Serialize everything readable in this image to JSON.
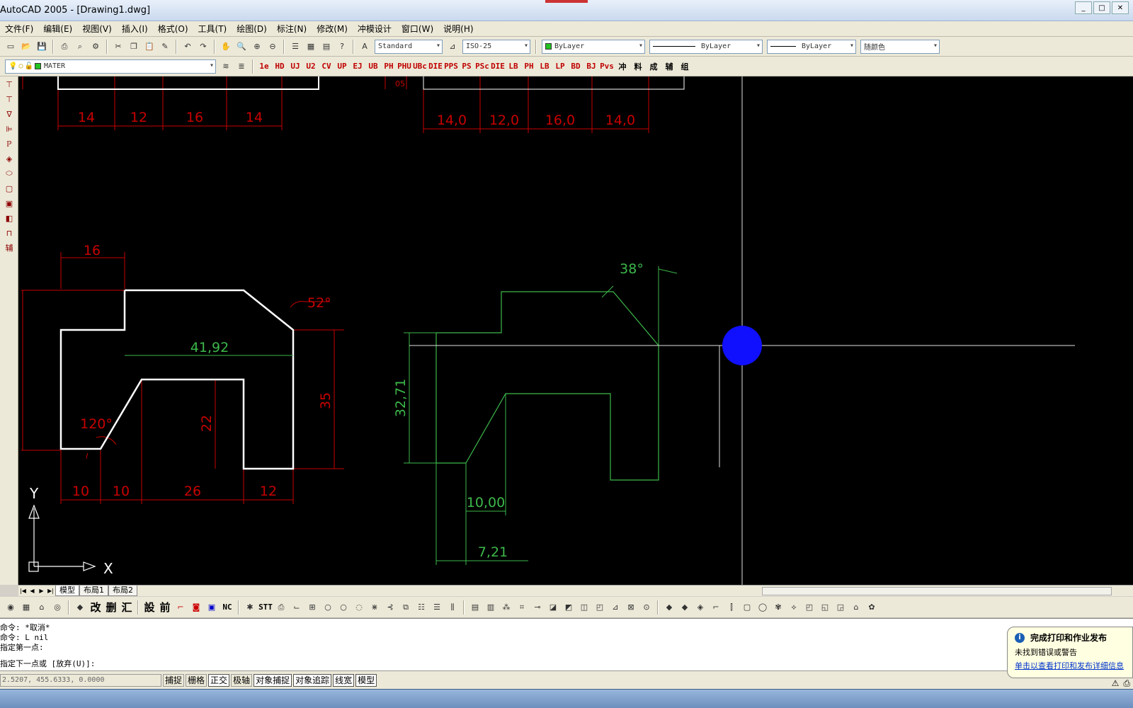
{
  "window": {
    "title": "AutoCAD 2005 - [Drawing1.dwg]"
  },
  "menu": [
    "文件(F)",
    "编辑(E)",
    "视图(V)",
    "插入(I)",
    "格式(O)",
    "工具(T)",
    "绘图(D)",
    "标注(N)",
    "修改(M)",
    "冲模设计",
    "窗口(W)",
    "说明(H)"
  ],
  "toolbar": {
    "text_style": "Standard",
    "dim_style": "ISO-25",
    "layer_color": "ByLayer",
    "linetype": "ByLayer",
    "lineweight": "ByLayer",
    "plot_style": "随颜色",
    "layer_name": "MATER"
  },
  "custom_buttons": [
    "1e",
    "HD",
    "UJ",
    "U2",
    "CV",
    "UP",
    "EJ",
    "UB",
    "PH",
    "PHU",
    "UBc",
    "DIE",
    "PPS",
    "PS",
    "PSc",
    "DIE",
    "LB",
    "PH",
    "LB",
    "LP",
    "BD",
    "BJ",
    "Pvs",
    "冲",
    "料",
    "成",
    "辅",
    "组"
  ],
  "bottom_toolbar": [
    "改",
    "删",
    "汇",
    "設",
    "前",
    "STT",
    "NC"
  ],
  "drawing": {
    "colors": {
      "red": "#c80000",
      "green": "#3cb84a",
      "white": "#ffffff",
      "blue": "#1010ff",
      "crosshair": "#e0e0e0"
    },
    "left_top_dims": [
      "14",
      "12",
      "16",
      "14"
    ],
    "right_top_dims": [
      "14,0",
      "12,0",
      "16,0",
      "14,0"
    ],
    "left_part": {
      "dim_top": "16",
      "angle_top": "52°",
      "width_label": "41,92",
      "height_label": "35",
      "inner_height": "22",
      "angle_bottom": "120°",
      "bottom_dims": [
        "10",
        "10",
        "26",
        "12"
      ]
    },
    "right_part": {
      "angle": "38°",
      "height_label": "32,71",
      "dim_a": "10,00",
      "dim_b": "7,21"
    },
    "ucs": {
      "x": "X",
      "y": "Y"
    },
    "top_small_label": "05"
  },
  "layout_tabs": [
    "模型",
    "布局1",
    "布局2"
  ],
  "command_lines": [
    "命令: *取消*",
    "命令: L nil",
    "指定第一点:"
  ],
  "command_prompt": "指定下一点或 [放弃(U)]:",
  "status": {
    "coords": "2.5207,  455.6333, 0.0000",
    "buttons": [
      "捕捉",
      "栅格",
      "正交",
      "极轴",
      "对象捕捉",
      "对象追踪",
      "线宽",
      "模型"
    ],
    "on": [
      2,
      4,
      5,
      6,
      7
    ]
  },
  "notification": {
    "title": "完成打印和作业发布",
    "line1": "未找到错误或警告",
    "link": "单击以查看打印和发布详细信息"
  }
}
